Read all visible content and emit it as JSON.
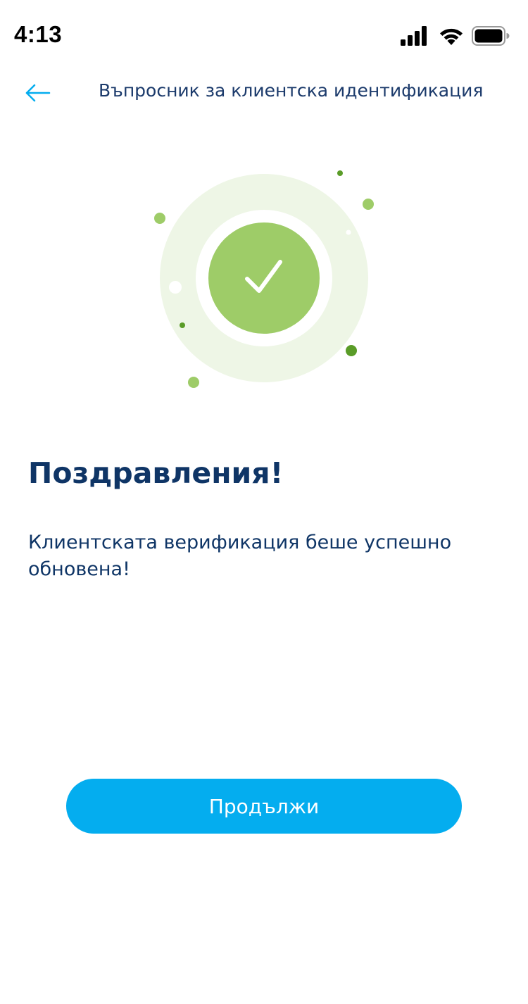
{
  "status_bar": {
    "time": "4:13",
    "signal_icon": "cellular-signal-icon",
    "wifi_icon": "wifi-icon",
    "battery_icon": "battery-icon"
  },
  "header": {
    "back_icon": "arrow-left-icon",
    "title": "Въпросник за клиентска идентификация"
  },
  "illustration": {
    "icon": "checkmark-success-icon"
  },
  "content": {
    "headline": "Поздравления!",
    "message": "Клиентската верификация беше успешно обновена!"
  },
  "actions": {
    "continue_label": "Продължи"
  },
  "colors": {
    "primary": "#04adef",
    "heading": "#0f3566",
    "success": "#9ecc68",
    "success_light": "#eef6e6",
    "accent_dark_green": "#5a9c28"
  }
}
